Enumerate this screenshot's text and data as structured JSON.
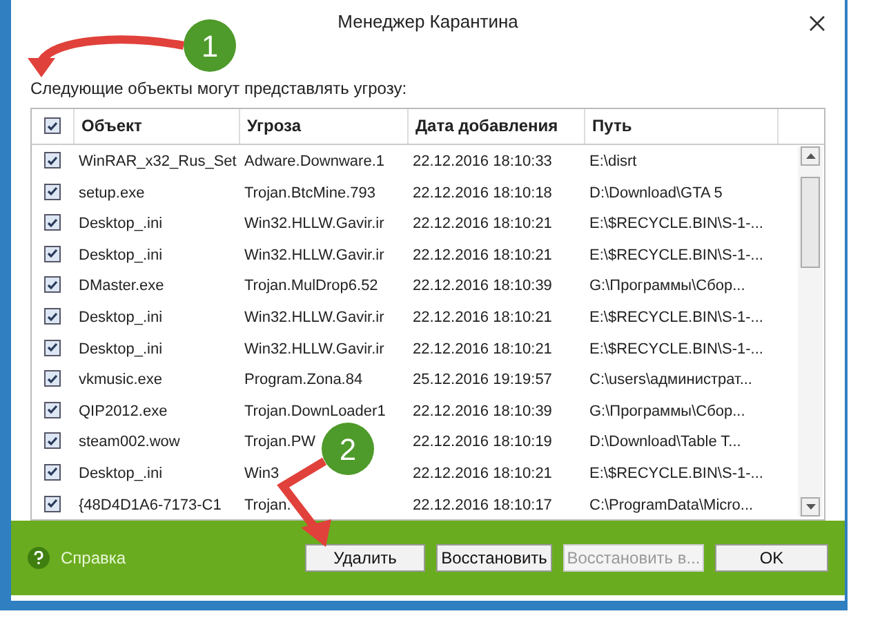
{
  "window": {
    "title": "Менеджер Карантина"
  },
  "caption": "Следующие объекты могут представлять угрозу:",
  "table": {
    "all_checked": true,
    "columns": [
      "Объект",
      "Угроза",
      "Дата добавления",
      "Путь"
    ],
    "rows": [
      {
        "checked": true,
        "cells": [
          "WinRAR_x32_Rus_Set",
          "Adware.Downware.1",
          "22.12.2016 18:10:33",
          "E:\\disrt"
        ]
      },
      {
        "checked": true,
        "cells": [
          "setup.exe",
          "Trojan.BtcMine.793",
          "22.12.2016 18:10:18",
          "D:\\Download\\GTA 5"
        ]
      },
      {
        "checked": true,
        "cells": [
          "Desktop_.ini",
          "Win32.HLLW.Gavir.ir",
          "22.12.2016 18:10:21",
          "E:\\$RECYCLE.BIN\\S-1-..."
        ]
      },
      {
        "checked": true,
        "cells": [
          "Desktop_.ini",
          "Win32.HLLW.Gavir.ir",
          "22.12.2016 18:10:21",
          "E:\\$RECYCLE.BIN\\S-1-..."
        ]
      },
      {
        "checked": true,
        "cells": [
          "DMaster.exe",
          "Trojan.MulDrop6.52",
          "22.12.2016 18:10:39",
          "G:\\Программы\\Сбор..."
        ]
      },
      {
        "checked": true,
        "cells": [
          "Desktop_.ini",
          "Win32.HLLW.Gavir.ir",
          "22.12.2016 18:10:21",
          "E:\\$RECYCLE.BIN\\S-1-..."
        ]
      },
      {
        "checked": true,
        "cells": [
          "Desktop_.ini",
          "Win32.HLLW.Gavir.ir",
          "22.12.2016 18:10:21",
          "E:\\$RECYCLE.BIN\\S-1-..."
        ]
      },
      {
        "checked": true,
        "cells": [
          "vkmusic.exe",
          "Program.Zona.84",
          "25.12.2016 19:19:57",
          "C:\\users\\администрат..."
        ]
      },
      {
        "checked": true,
        "cells": [
          "QIP2012.exe",
          "Trojan.DownLoader1",
          "22.12.2016 18:10:39",
          "G:\\Программы\\Сбор..."
        ]
      },
      {
        "checked": true,
        "cells": [
          "steam002.wow",
          "Trojan.PW",
          "22.12.2016 18:10:19",
          "D:\\Download\\Table T..."
        ]
      },
      {
        "checked": true,
        "cells": [
          "Desktop_.ini",
          "Win3",
          "22.12.2016 18:10:21",
          "E:\\$RECYCLE.BIN\\S-1-..."
        ]
      },
      {
        "checked": true,
        "cells": [
          "{48D4D1A6-7173-C1",
          "Trojan.",
          "22.12.2016 18:10:17",
          "C:\\ProgramData\\Micro..."
        ]
      }
    ]
  },
  "help": "Справка",
  "buttons": [
    {
      "label": "Удалить",
      "disabled": false
    },
    {
      "label": "Восстановить",
      "disabled": false
    },
    {
      "label": "Восстановить в...",
      "disabled": true
    },
    {
      "label": "OK",
      "disabled": false
    }
  ],
  "callouts": [
    "1",
    "2"
  ]
}
